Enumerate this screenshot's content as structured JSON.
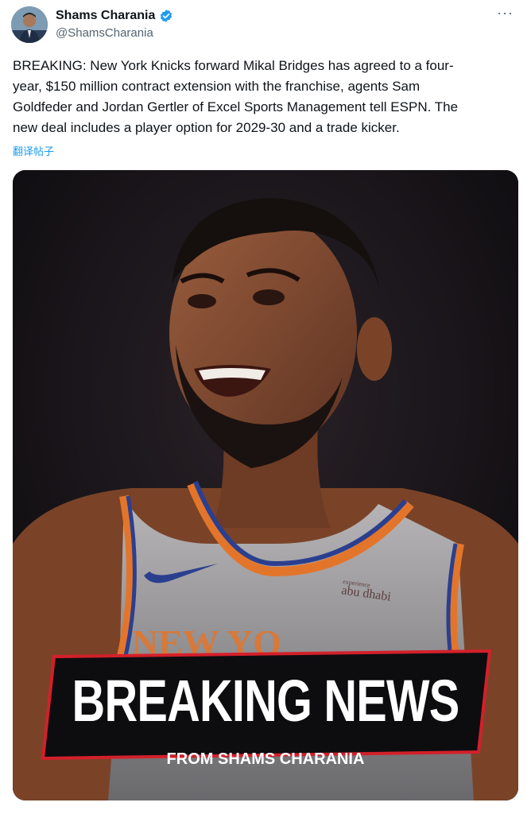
{
  "author": {
    "display_name": "Shams Charania",
    "handle": "@ShamsCharania"
  },
  "menu": {
    "more_label": "···"
  },
  "post": {
    "text": "BREAKING: New York Knicks forward Mikal Bridges has agreed to a four-\nyear, $150 million contract extension with the franchise, agents Sam\nGoldfeder and Jordan Gertler of Excel Sports Management tell ESPN. The\nnew deal includes a player option for 2029-30 and a trade kicker.",
    "translate_label": "翻译帖子"
  },
  "media": {
    "banner_title": "BREAKING NEWS",
    "banner_subtitle": "FROM SHAMS CHARANIA",
    "jersey_sponsor": "abu dhabi",
    "jersey_sponsor_small": "experience"
  },
  "colors": {
    "verified_blue": "#1d9bf0",
    "banner_red": "#d3202a",
    "jersey_orange": "#e3752b",
    "jersey_blue": "#2b3f8f"
  }
}
